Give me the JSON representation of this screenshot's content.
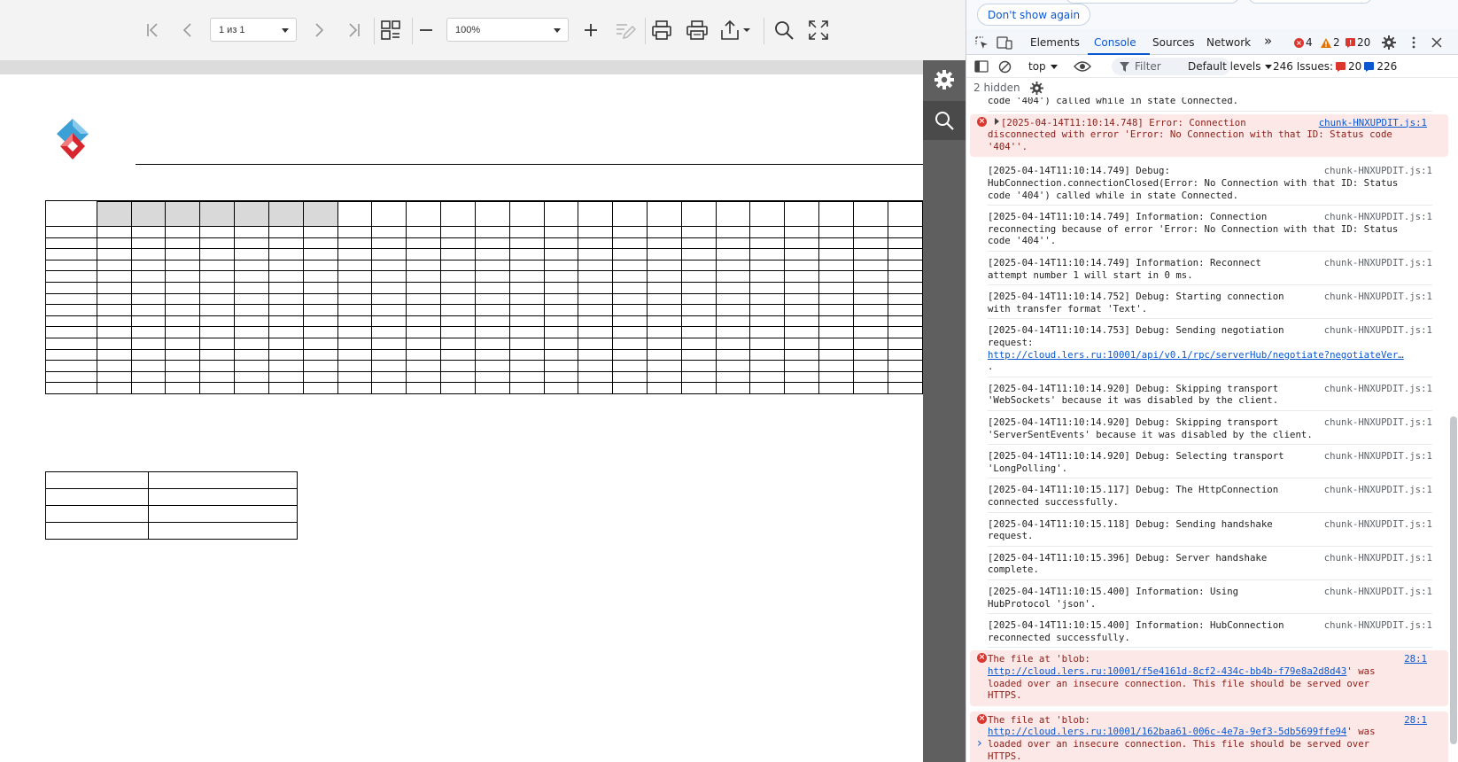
{
  "viewer": {
    "page_select_value": "1 из 1",
    "zoom_select_value": "100%",
    "icons": {
      "first": "first-page-icon",
      "prev": "prev-page-icon",
      "next": "next-page-icon",
      "last": "last-page-icon",
      "view_mode": "view-mode-icon",
      "zoom_out": "zoom-out-icon",
      "zoom_in": "zoom-in-icon",
      "edit": "edit-icon",
      "print": "print-icon",
      "print_preview": "print-preview-icon",
      "export": "export-icon",
      "search": "search-icon",
      "fullscreen": "fullscreen-icon",
      "settings": "gear-icon",
      "side_search": "search-icon"
    },
    "colors": {
      "toolbar_bg": "#f3f3f3",
      "side_panel_bg": "#5f5f5f",
      "shaded_cell": "#d9d9d9"
    }
  },
  "devtools": {
    "dont_show_again": "Don't show again",
    "tabs": [
      {
        "label": "Elements",
        "active": false
      },
      {
        "label": "Console",
        "active": true
      },
      {
        "label": "Sources",
        "active": false
      },
      {
        "label": "Network",
        "active": false
      }
    ],
    "more_tabs": "»",
    "counts": {
      "errors": "4",
      "warnings": "2",
      "issues": "20"
    },
    "filterbar": {
      "context": "top",
      "filter_placeholder": "Filter",
      "levels": "Default levels",
      "issues_label": "246 Issues:",
      "issues_errors": "20",
      "issues_info": "226"
    },
    "hidden_label": "2 hidden",
    "messages": [
      {
        "type": "log",
        "lines": [
          "code '404') called while in state Connected."
        ],
        "source": ""
      },
      {
        "type": "error",
        "expandable": true,
        "lines": [
          "[2025-04-14T11:10:14.748] Error: Connection",
          "disconnected with error 'Error: No Connection with that ID: Status code",
          "'404''."
        ],
        "source": "chunk-HNXUPDIT.js:1"
      },
      {
        "type": "log",
        "lines": [
          "[2025-04-14T11:10:14.749] Debug:",
          "HubConnection.connectionClosed(Error: No Connection with that ID: Status",
          "code '404') called while in state Connected."
        ],
        "source": "chunk-HNXUPDIT.js:1"
      },
      {
        "type": "log",
        "lines": [
          "[2025-04-14T11:10:14.749] Information: Connection",
          "reconnecting because of error 'Error: No Connection with that ID: Status",
          "code '404''."
        ],
        "source": "chunk-HNXUPDIT.js:1"
      },
      {
        "type": "log",
        "lines": [
          "[2025-04-14T11:10:14.749] Information: Reconnect",
          "attempt number 1 will start in 0 ms."
        ],
        "source": "chunk-HNXUPDIT.js:1"
      },
      {
        "type": "log",
        "lines": [
          "[2025-04-14T11:10:14.752] Debug: Starting connection",
          "with transfer format 'Text'."
        ],
        "source": "chunk-HNXUPDIT.js:1"
      },
      {
        "type": "log",
        "lines": [
          "[2025-04-14T11:10:14.753] Debug: Sending negotiation",
          "request:",
          "http://cloud.lers.ru:10001/api/v0.1/rpc/serverHub/negotiate?negotiateVer…",
          "."
        ],
        "link_line": 2,
        "source": "chunk-HNXUPDIT.js:1"
      },
      {
        "type": "log",
        "lines": [
          "[2025-04-14T11:10:14.920] Debug: Skipping transport",
          "'WebSockets' because it was disabled by the client."
        ],
        "source": "chunk-HNXUPDIT.js:1"
      },
      {
        "type": "log",
        "lines": [
          "[2025-04-14T11:10:14.920] Debug: Skipping transport",
          "'ServerSentEvents' because it was disabled by the client."
        ],
        "source": "chunk-HNXUPDIT.js:1"
      },
      {
        "type": "log",
        "lines": [
          "[2025-04-14T11:10:14.920] Debug: Selecting transport",
          "'LongPolling'."
        ],
        "source": "chunk-HNXUPDIT.js:1"
      },
      {
        "type": "log",
        "lines": [
          "[2025-04-14T11:10:15.117] Debug: The HttpConnection",
          "connected successfully."
        ],
        "source": "chunk-HNXUPDIT.js:1"
      },
      {
        "type": "log",
        "lines": [
          "[2025-04-14T11:10:15.118] Debug: Sending handshake",
          "request."
        ],
        "source": "chunk-HNXUPDIT.js:1"
      },
      {
        "type": "log",
        "lines": [
          "[2025-04-14T11:10:15.396] Debug: Server handshake",
          "complete."
        ],
        "source": "chunk-HNXUPDIT.js:1"
      },
      {
        "type": "log",
        "lines": [
          "[2025-04-14T11:10:15.400] Information: Using",
          "HubProtocol 'json'."
        ],
        "source": "chunk-HNXUPDIT.js:1"
      },
      {
        "type": "log",
        "lines": [
          "[2025-04-14T11:10:15.400] Information: HubConnection",
          "reconnected successfully."
        ],
        "source": "chunk-HNXUPDIT.js:1"
      },
      {
        "type": "error",
        "expandable": false,
        "lines": [
          "The file at 'blob:",
          "http://cloud.lers.ru:10001/f5e4161d-8cf2-434c-bb4b-f79e8a2d8d43' was",
          "loaded over an insecure connection. This file should be served over",
          "HTTPS."
        ],
        "link_line": 1,
        "link_text": "http://cloud.lers.ru:10001/f5e4161d-8cf2-434c-bb4b-f79e8a2d8d43",
        "source": "28:1"
      },
      {
        "type": "error",
        "expandable": false,
        "lines": [
          "The file at 'blob:",
          "http://cloud.lers.ru:10001/162baa61-006c-4e7a-9ef3-5db5699ffe94' was",
          "loaded over an insecure connection. This file should be served over",
          "HTTPS."
        ],
        "link_line": 1,
        "link_text": "http://cloud.lers.ru:10001/162baa61-006c-4e7a-9ef3-5db5699ffe94",
        "source": "28:1"
      }
    ],
    "prompt": "›"
  }
}
